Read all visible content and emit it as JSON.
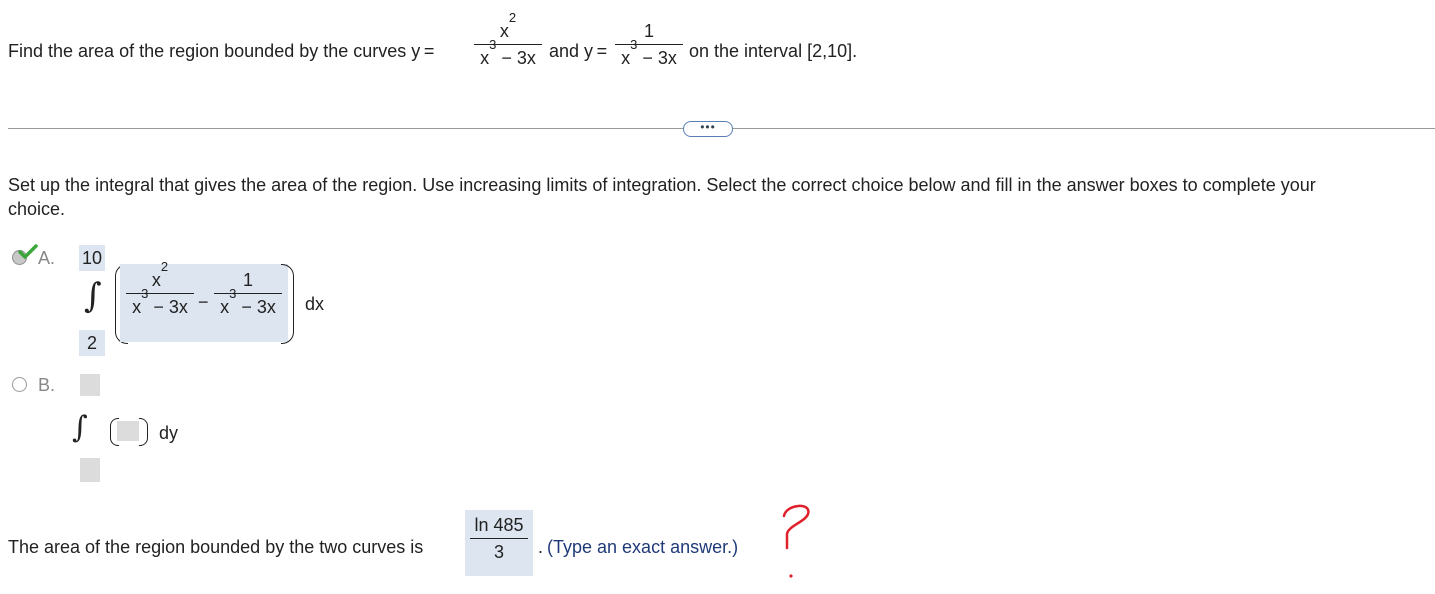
{
  "question": {
    "prefix": "Find the area of the region bounded by the curves y =",
    "f1_num_base": "x",
    "f1_num_exp": "2",
    "f1_den_base": "x",
    "f1_den_exp": "3",
    "f1_den_rest": " − 3x",
    "and_text": "and y =",
    "f2_num": "1",
    "f2_den_base": "x",
    "f2_den_exp": "3",
    "f2_den_rest": " − 3x",
    "suffix": "on the interval [2,10]."
  },
  "more_button": "•••",
  "instruction": {
    "line1": "Set up the integral that gives the area of the region. Use increasing limits of integration. Select the correct choice below and fill in the answer boxes to complete your",
    "line2": "choice."
  },
  "choice_a": {
    "label": "A.",
    "upper": "10",
    "lower": "2",
    "int_symbol": "∫",
    "t1_num_base": "x",
    "t1_num_exp": "2",
    "t1_den_base": "x",
    "t1_den_exp": "3",
    "t1_den_rest": " − 3x",
    "minus": "−",
    "t2_num": "1",
    "t2_den_base": "x",
    "t2_den_exp": "3",
    "t2_den_rest": " − 3x",
    "dvar": "dx",
    "selected": true,
    "status": "correct"
  },
  "choice_b": {
    "label": "B.",
    "int_symbol": "∫",
    "dvar": "dy",
    "selected": false
  },
  "answer": {
    "prefix": "The area of the region bounded by the two curves is",
    "numerator": "ln 485",
    "denominator": "3",
    "period": ".",
    "hint": "(Type an exact answer.)"
  },
  "annotation": {
    "mark": "?",
    "color": "#e0202a"
  },
  "colors": {
    "shaded_box": "#dde5f0",
    "empty_box": "#dcdcdc",
    "check_green": "#3aa63a",
    "hint_blue": "#1f3a78"
  }
}
